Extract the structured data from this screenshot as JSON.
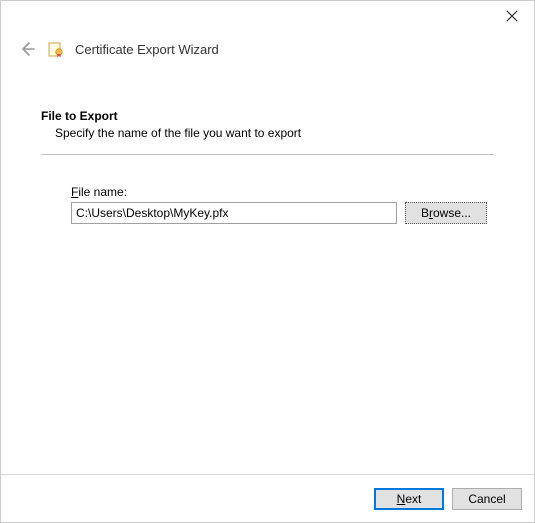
{
  "window": {
    "title": "Certificate Export Wizard"
  },
  "section": {
    "heading": "File to Export",
    "description": "Specify the name of the file you want to export"
  },
  "file": {
    "label_pre": "F",
    "label_rest": "ile name:",
    "value": "C:\\Users\\Desktop\\MyKey.pfx",
    "browse_pre": "B",
    "browse_mid": "r",
    "browse_post": "owse..."
  },
  "footer": {
    "next_pre": "",
    "next_u": "N",
    "next_post": "ext",
    "cancel": "Cancel"
  }
}
